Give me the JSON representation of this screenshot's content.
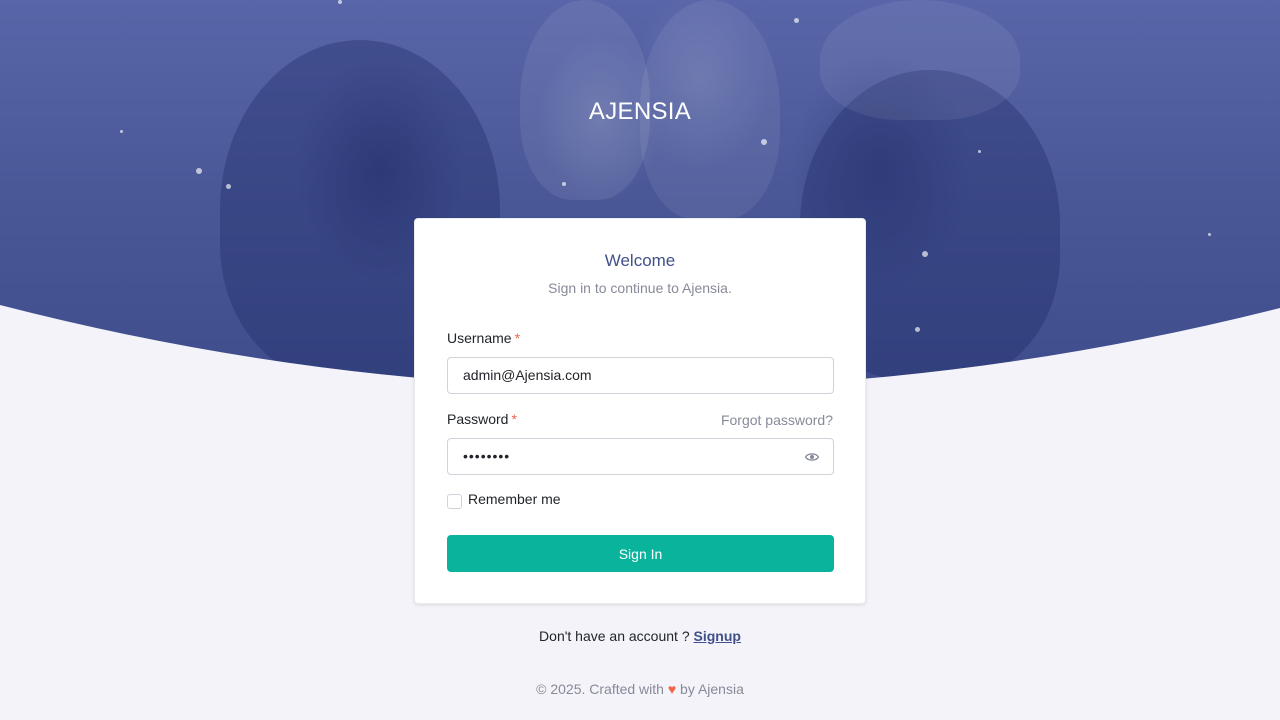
{
  "brand": {
    "name": "AJENSIA"
  },
  "card": {
    "title": "Welcome",
    "subtitle": "Sign in to continue to Ajensia.",
    "username": {
      "label": "Username",
      "required_mark": "*",
      "value": "admin@Ajensia.com"
    },
    "password": {
      "label": "Password",
      "required_mark": "*",
      "value": "••••••••",
      "forgot_label": "Forgot password?",
      "toggle_icon": "eye-icon"
    },
    "remember": {
      "label": "Remember me",
      "checked": false
    },
    "submit_label": "Sign In"
  },
  "signup": {
    "prompt": "Don't have an account ? ",
    "link_label": "Signup"
  },
  "footer": {
    "prefix": "© 2025. Crafted with ",
    "heart": "♥",
    "suffix": " by Ajensia"
  },
  "colors": {
    "primary": "#405189",
    "success": "#0ab39c",
    "danger": "#f06548",
    "muted": "#878a99",
    "page_bg": "#f3f3f9"
  }
}
